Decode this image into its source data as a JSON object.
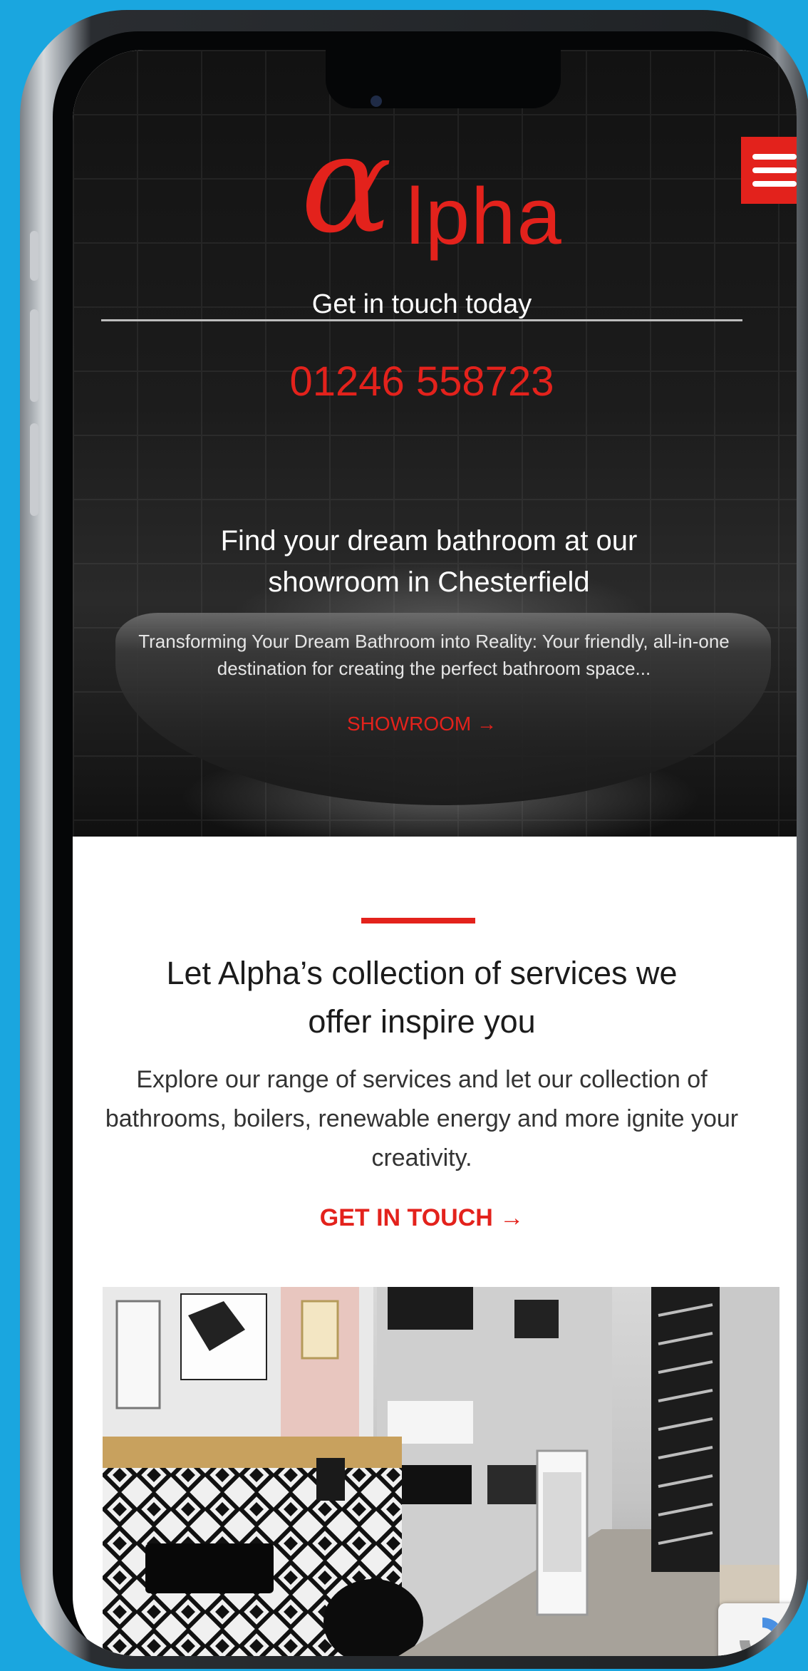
{
  "brand": {
    "logo_alpha": "α",
    "logo_rest": "lpha",
    "accent_color": "#e3221c"
  },
  "header": {
    "contact_label": "Get in touch today",
    "phone": "01246 558723"
  },
  "hero": {
    "title": "Find your dream bathroom at our showroom in Chesterfield",
    "text": "Transforming Your Dream Bathroom into Reality: Your friendly, all-in-one destination for creating the perfect bathroom space...",
    "link_label": "SHOWROOM →"
  },
  "services": {
    "title": "Let Alpha’s collection of services we offer inspire you",
    "text": "Explore our range of services and let our collection of bathrooms, boilers, renewable energy and more ignite your creativity.",
    "link_label": "GET IN TOUCH  →"
  },
  "icons": {
    "menu": "hamburger-menu-icon",
    "recaptcha": "recaptcha-icon"
  }
}
